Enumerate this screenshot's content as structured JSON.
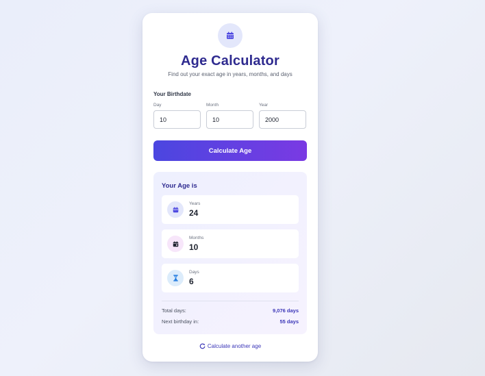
{
  "header": {
    "title": "Age Calculator",
    "subtitle": "Find out your exact age in years, months, and days",
    "logo_icon": "calendar-icon",
    "accent_color": "#2e2a8f"
  },
  "form": {
    "section_label": "Your Birthdate",
    "day": {
      "label": "Day",
      "value": "10"
    },
    "month": {
      "label": "Month",
      "value": "10"
    },
    "year": {
      "label": "Year",
      "value": "2000"
    },
    "submit_label": "Calculate Age",
    "button_gradient": [
      "#4b46e0",
      "#7a3ae3"
    ]
  },
  "result": {
    "title": "Your Age is",
    "stats": [
      {
        "label": "Years",
        "value": "24",
        "icon": "calendar-icon",
        "icon_bg": "#e3e7fb",
        "icon_color": "#4b46e0"
      },
      {
        "label": "Months",
        "value": "10",
        "icon": "calendar-month-icon",
        "icon_bg": "#f7e6fa",
        "icon_color": "#1f2430"
      },
      {
        "label": "Days",
        "value": "6",
        "icon": "hourglass-icon",
        "icon_bg": "#dcecfb",
        "icon_color": "#1f7ae0"
      }
    ],
    "summary": [
      {
        "label": "Total days:",
        "value": "9,076 days"
      },
      {
        "label": "Next birthday in:",
        "value": "55 days"
      }
    ]
  },
  "footer": {
    "again_label": "Calculate another age",
    "again_icon": "refresh-icon"
  }
}
